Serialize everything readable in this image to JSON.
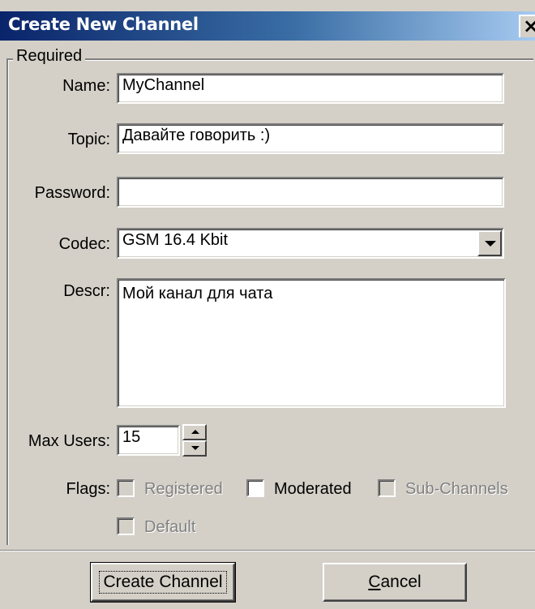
{
  "window": {
    "title": "Create New Channel",
    "close_glyph": "×"
  },
  "group": {
    "legend": "Required"
  },
  "fields": {
    "name": {
      "label": "Name:",
      "value": "MyChannel"
    },
    "topic": {
      "label": "Topic:",
      "value": "Давайте говорить :)"
    },
    "password": {
      "label": "Password:",
      "value": ""
    },
    "codec": {
      "label": "Codec:",
      "value": "GSM 16.4 Kbit"
    },
    "descr": {
      "label": "Descr:",
      "value": "Мой канал для чата"
    },
    "max_users": {
      "label": "Max Users:",
      "value": "15"
    }
  },
  "flags": {
    "label": "Flags:",
    "registered": {
      "label": "Registered",
      "checked": false,
      "enabled": false
    },
    "moderated": {
      "label": "Moderated",
      "checked": false,
      "enabled": true
    },
    "sub_channels": {
      "label": "Sub-Channels",
      "checked": false,
      "enabled": false
    },
    "default": {
      "label": "Default",
      "checked": false,
      "enabled": false
    }
  },
  "buttons": {
    "create": "Create Channel",
    "cancel_first": "C",
    "cancel_rest": "ancel"
  },
  "colors": {
    "titlebar_start": "#0a246a",
    "titlebar_end": "#a6caf0",
    "dialog_face": "#d4d0c8"
  }
}
